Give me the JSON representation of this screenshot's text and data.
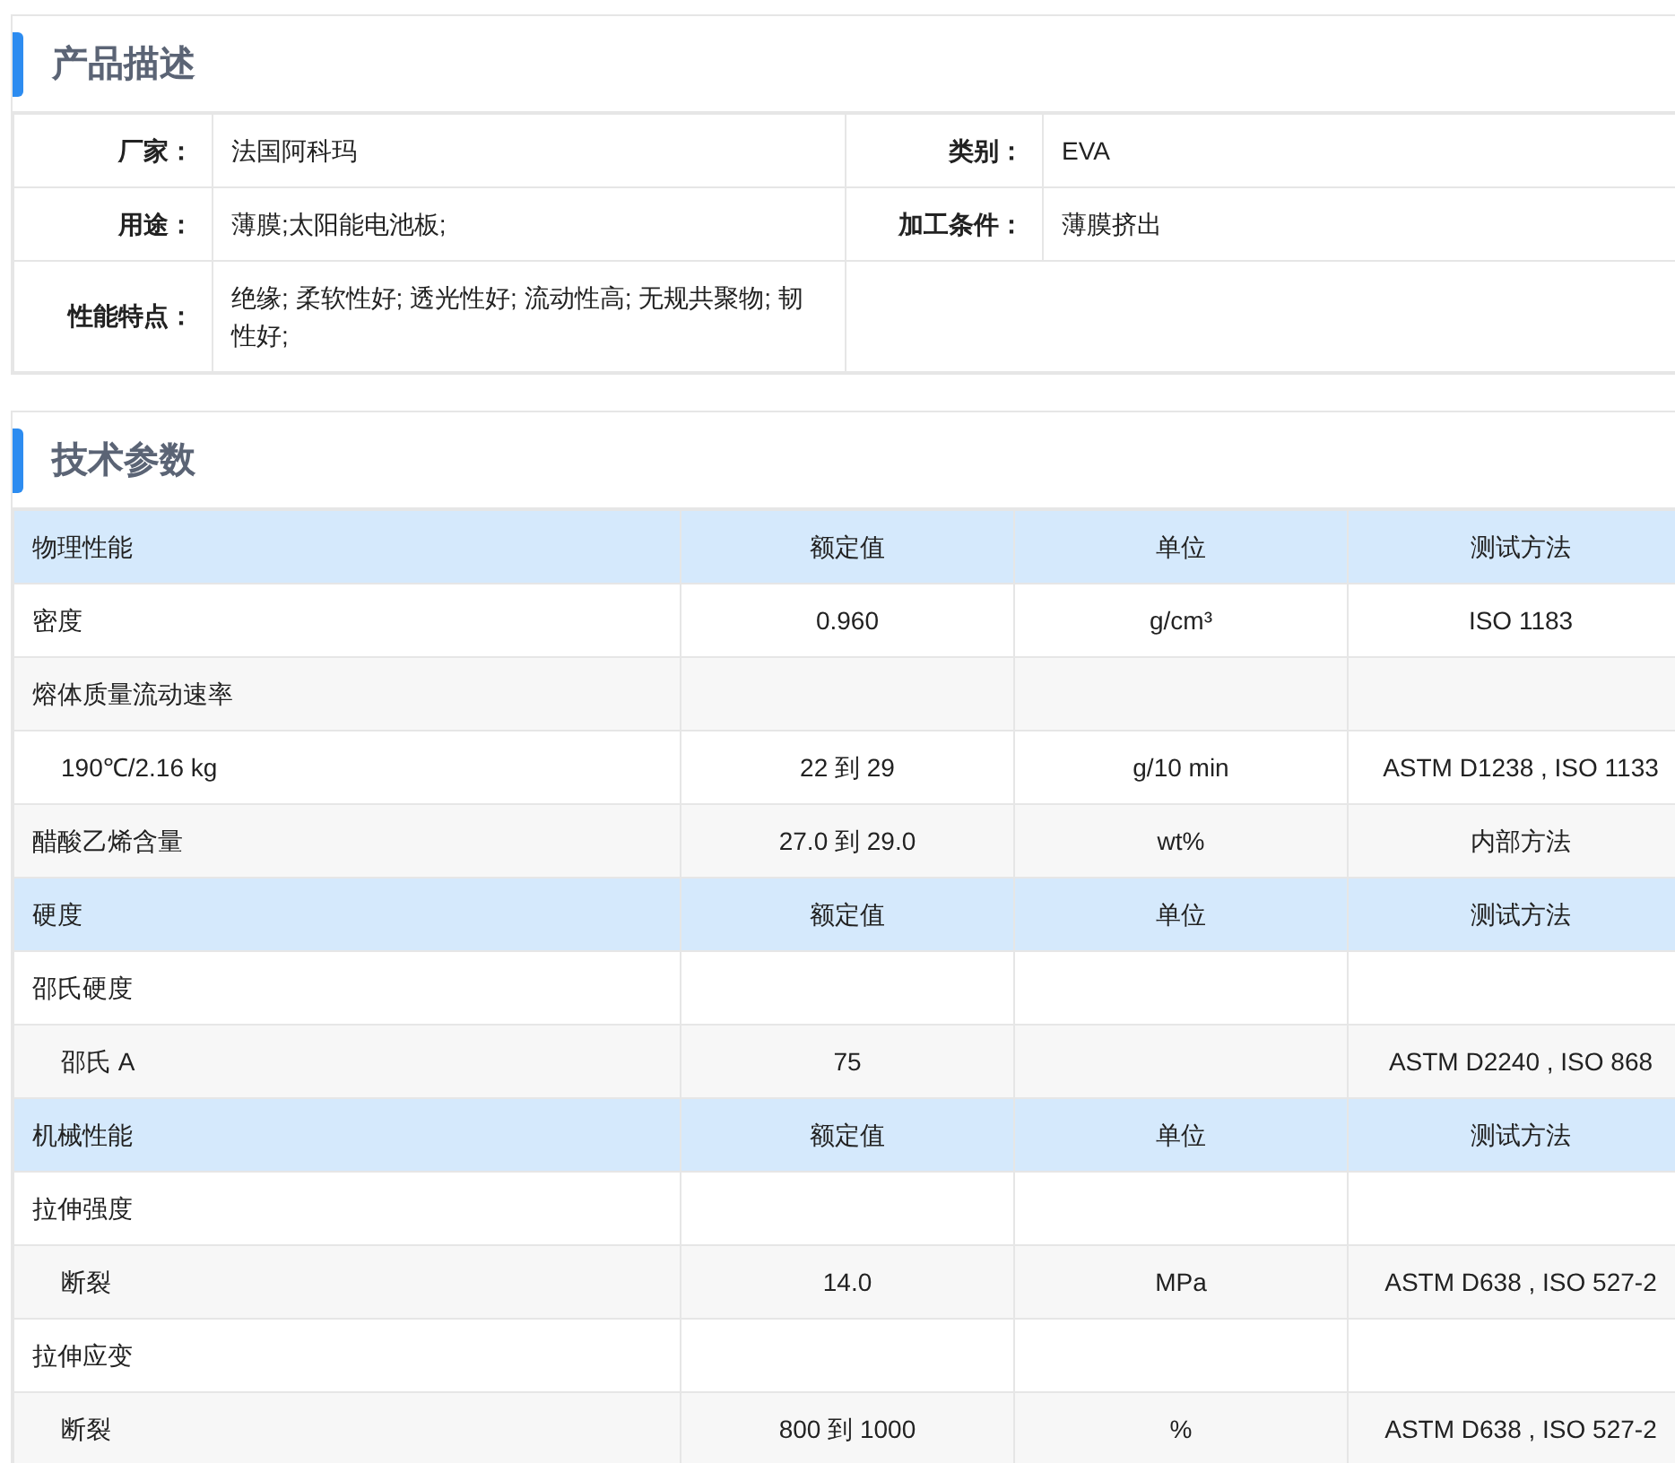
{
  "description": {
    "title": "产品描述",
    "rows": [
      [
        {
          "label": "厂家：",
          "value": "法国阿科玛"
        },
        {
          "label": "类别：",
          "value": "EVA"
        }
      ],
      [
        {
          "label": "用途：",
          "value": "薄膜;太阳能电池板;"
        },
        {
          "label": "加工条件：",
          "value": "薄膜挤出"
        }
      ],
      [
        {
          "label": "性能特点：",
          "value": "绝缘; 柔软性好; 透光性好; 流动性高; 无规共聚物; 韧性好;"
        }
      ]
    ]
  },
  "parameters": {
    "title": "技术参数",
    "sections": [
      {
        "header": {
          "name": "物理性能",
          "value": "额定值",
          "unit": "单位",
          "method": "测试方法"
        },
        "rows": [
          {
            "kind": "property",
            "name": "密度",
            "value": "0.960",
            "unit": "g/cm³",
            "method": "ISO 1183"
          },
          {
            "kind": "property",
            "name": "熔体质量流动速率"
          },
          {
            "kind": "condition",
            "name": "190℃/2.16 kg",
            "value": "22 到 29",
            "unit": "g/10 min",
            "method": "ASTM D1238 , ISO 1133"
          },
          {
            "kind": "property",
            "name": "醋酸乙烯含量",
            "value": "27.0 到 29.0",
            "unit": "wt%",
            "method": "内部方法"
          }
        ]
      },
      {
        "header": {
          "name": "硬度",
          "value": "额定值",
          "unit": "单位",
          "method": "测试方法"
        },
        "rows": [
          {
            "kind": "property",
            "name": "邵氏硬度"
          },
          {
            "kind": "condition",
            "name": "邵氏 A",
            "value": "75",
            "method": "ASTM D2240 , ISO 868"
          }
        ]
      },
      {
        "header": {
          "name": "机械性能",
          "value": "额定值",
          "unit": "单位",
          "method": "测试方法"
        },
        "rows": [
          {
            "kind": "property",
            "name": "拉伸强度"
          },
          {
            "kind": "condition",
            "name": "断裂",
            "value": "14.0",
            "unit": "MPa",
            "method": "ASTM D638 , ISO 527-2"
          },
          {
            "kind": "property",
            "name": "拉伸应变"
          },
          {
            "kind": "condition",
            "name": "断裂",
            "value": "800 到 1000",
            "unit": "%",
            "method": "ASTM D638 , ISO 527-2"
          }
        ]
      }
    ]
  }
}
